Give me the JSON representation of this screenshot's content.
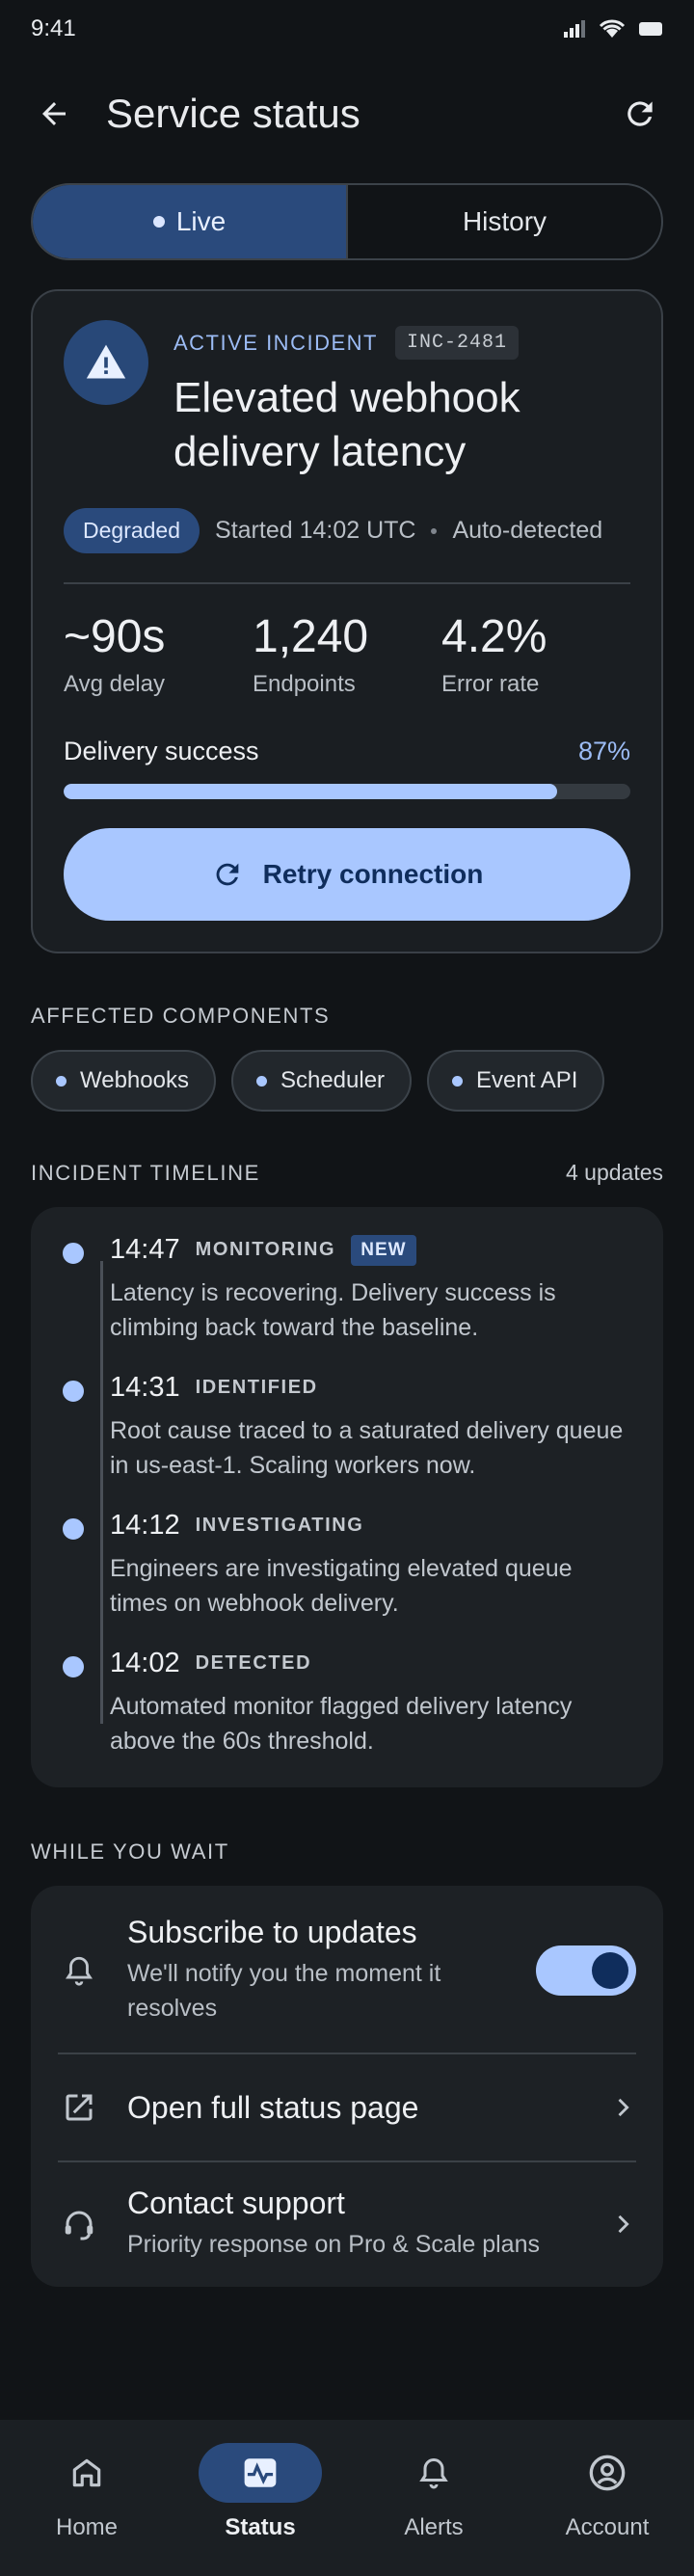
{
  "status_bar": {
    "time": "9:41"
  },
  "app_bar": {
    "title": "Service status"
  },
  "tabs": [
    {
      "label": "Live",
      "active": true
    },
    {
      "label": "History",
      "active": false
    }
  ],
  "incident": {
    "label": "ACTIVE INCIDENT",
    "id": "INC-2481",
    "title": "Elevated webhook delivery latency",
    "severity": "Degraded",
    "started": "Started 14:02 UTC",
    "source": "Auto-detected",
    "stats": [
      {
        "value": "~90s",
        "label": "Avg delay"
      },
      {
        "value": "1,240",
        "label": "Endpoints"
      },
      {
        "value": "4.2%",
        "label": "Error rate"
      }
    ],
    "progress_label": "Delivery success",
    "progress_text": "87%",
    "progress_value": 87,
    "retry_label": "Retry connection"
  },
  "components": {
    "heading": "AFFECTED COMPONENTS",
    "items": [
      "Webhooks",
      "Scheduler",
      "Event API"
    ]
  },
  "timeline": {
    "heading": "INCIDENT TIMELINE",
    "count": "4 updates",
    "entries": [
      {
        "time": "14:47",
        "stage": "MONITORING",
        "badge": "NEW",
        "text": "Latency is recovering. Delivery success is climbing back toward the baseline."
      },
      {
        "time": "14:31",
        "stage": "IDENTIFIED",
        "text": "Root cause traced to a saturated delivery queue in us-east-1. Scaling workers now."
      },
      {
        "time": "14:12",
        "stage": "INVESTIGATING",
        "text": "Engineers are investigating elevated queue times on webhook delivery."
      },
      {
        "time": "14:02",
        "stage": "DETECTED",
        "text": "Automated monitor flagged delivery latency above the 60s threshold."
      }
    ]
  },
  "wait": {
    "heading": "WHILE YOU WAIT",
    "subscribe": {
      "title": "Subscribe to updates",
      "subtitle": "We'll notify you the moment it resolves",
      "enabled": true
    },
    "status_page": {
      "title": "Open full status page"
    },
    "support": {
      "title": "Contact support",
      "subtitle": "Priority response on Pro & Scale plans"
    }
  },
  "nav": [
    {
      "label": "Home",
      "icon": "home-icon"
    },
    {
      "label": "Status",
      "icon": "activity-icon",
      "active": true
    },
    {
      "label": "Alerts",
      "icon": "bell-icon"
    },
    {
      "label": "Account",
      "icon": "account-icon"
    }
  ],
  "colors": {
    "accent": "#a9c7ff",
    "accent_dark": "#2a4a7c",
    "background": "#111417",
    "card": "#1d2125"
  }
}
